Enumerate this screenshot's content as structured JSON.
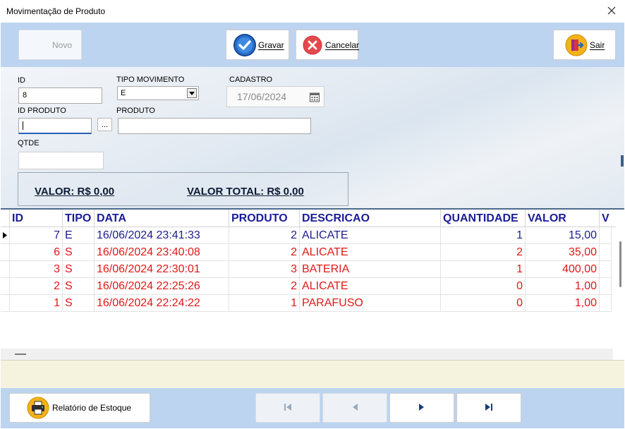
{
  "window": {
    "title": "Movimentação de Produto"
  },
  "toolbar": {
    "novo_label": "Novo",
    "gravar_label": "Gravar",
    "cancelar_label": "Cancelar",
    "sair_label": "Sair"
  },
  "form": {
    "id_label": "ID",
    "id_value": "8",
    "tipo_movimento_label": "TIPO MOVIMENTO",
    "tipo_movimento_value": "E",
    "cadastro_label": "CADASTRO",
    "cadastro_value": "17/06/2024",
    "id_produto_label": "ID PRODUTO",
    "id_produto_value": "",
    "lookup_label": "...",
    "produto_label": "PRODUTO",
    "produto_value": "",
    "qtde_label": "QTDE",
    "qtde_value": "",
    "valor_text": "VALOR: R$ 0,00",
    "valor_total_text": "VALOR TOTAL: R$ 0,00"
  },
  "grid": {
    "columns": [
      "ID",
      "TIPO",
      "DATA",
      "PRODUTO",
      "DESCRICAO",
      "QUANTIDADE",
      "VALOR",
      "V"
    ],
    "rows": [
      {
        "id": "7",
        "tipo": "E",
        "data": "16/06/2024 23:41:33",
        "produto": "2",
        "descricao": "ALICATE",
        "quantidade": "1",
        "valor": "15,00",
        "color": "#1c1c8c"
      },
      {
        "id": "6",
        "tipo": "S",
        "data": "16/06/2024 23:40:08",
        "produto": "2",
        "descricao": "ALICATE",
        "quantidade": "2",
        "valor": "35,00",
        "color": "#e01818"
      },
      {
        "id": "3",
        "tipo": "S",
        "data": "16/06/2024 22:30:01",
        "produto": "3",
        "descricao": "BATERIA",
        "quantidade": "1",
        "valor": "400,00",
        "color": "#e01818"
      },
      {
        "id": "2",
        "tipo": "S",
        "data": "16/06/2024 22:25:26",
        "produto": "2",
        "descricao": "ALICATE",
        "quantidade": "0",
        "valor": "1,00",
        "color": "#e01818"
      },
      {
        "id": "1",
        "tipo": "S",
        "data": "16/06/2024 22:24:22",
        "produto": "1",
        "descricao": "PARAFUSO",
        "quantidade": "0",
        "valor": "1,00",
        "color": "#e01818"
      }
    ]
  },
  "footer": {
    "relatorio_label": "Relatório de Estoque"
  },
  "colors": {
    "toolbar_bg": "#bcd4ef",
    "header_text": "#1b1b9a",
    "entrada": "#1c1c8c",
    "saida": "#e01818",
    "status_bg": "#f5f2de"
  }
}
